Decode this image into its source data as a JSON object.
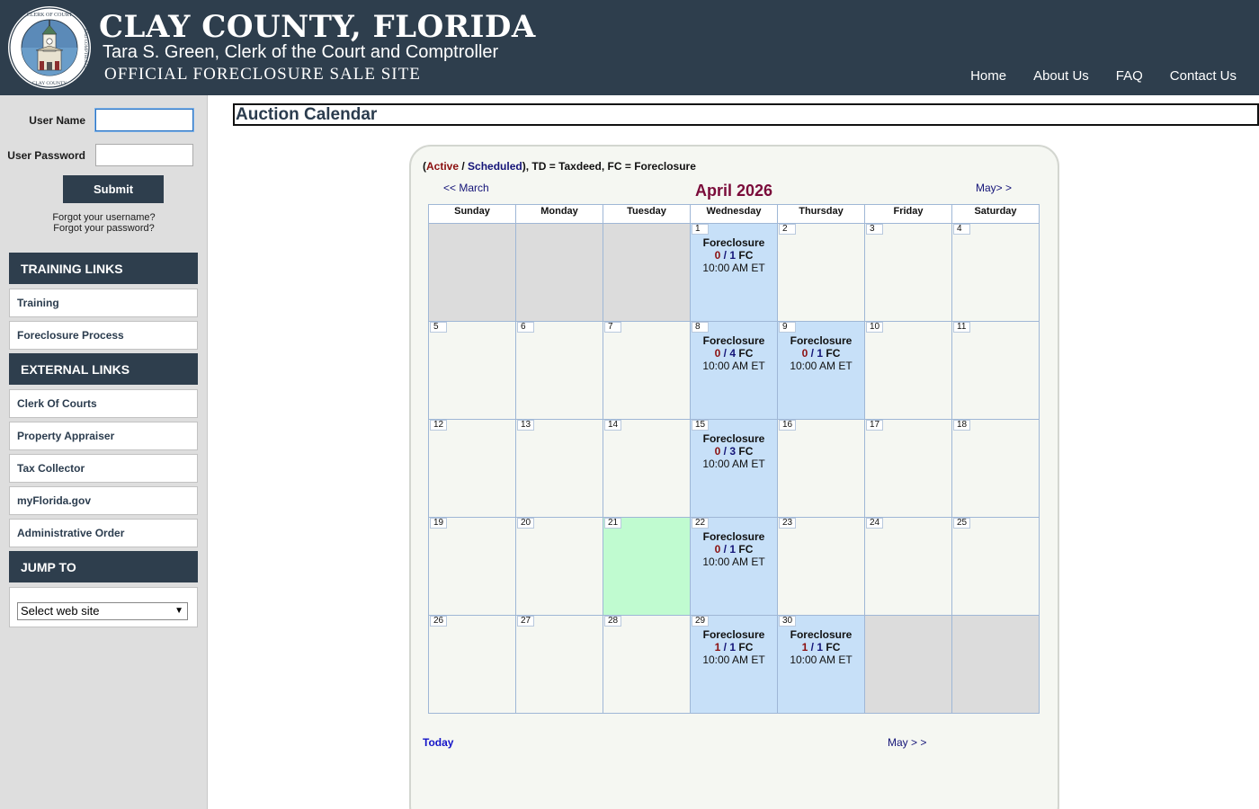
{
  "header": {
    "county": "CLAY COUNTY, FLORIDA",
    "clerk": "Tara S. Green, Clerk of the Court and Comptroller",
    "site": "OFFICIAL FORECLOSURE SALE SITE",
    "seal_top": "CLERK OF COURT",
    "seal_right": "AND COMPTROLLER",
    "seal_bottom": "CLAY COUNTY",
    "nav": [
      "Home",
      "About Us",
      "FAQ",
      "Contact Us"
    ]
  },
  "login": {
    "username_label": "User Name",
    "password_label": "User Password",
    "username_value": "",
    "password_value": "",
    "submit": "Submit",
    "forgot_username": "Forgot your username?",
    "forgot_password": "Forgot your password?"
  },
  "sidebar": {
    "training_head": "TRAINING LINKS",
    "training_links": [
      "Training",
      "Foreclosure Process"
    ],
    "external_head": "EXTERNAL LINKS",
    "external_links": [
      "Clerk Of Courts",
      "Property Appraiser",
      "Tax Collector",
      "myFlorida.gov",
      "Administrative Order"
    ],
    "jump_head": "JUMP TO",
    "jump_select": "Select web site"
  },
  "main": {
    "title": "Auction Calendar",
    "legend": {
      "open": "(",
      "active": "Active",
      "slash": " / ",
      "scheduled": "Scheduled",
      "rest": "), TD = Taxdeed, FC = Foreclosure"
    },
    "prev": "<< March",
    "next": "May> >",
    "month": "April 2026",
    "dow": [
      "Sunday",
      "Monday",
      "Tuesday",
      "Wednesday",
      "Thursday",
      "Friday",
      "Saturday"
    ],
    "weeks": [
      [
        {
          "day": "",
          "state": "empty"
        },
        {
          "day": "",
          "state": "empty"
        },
        {
          "day": "",
          "state": "empty"
        },
        {
          "day": "1",
          "state": "auction",
          "auction": {
            "type": "Foreclosure",
            "active": "0",
            "scheduled": "1",
            "code": "FC",
            "time": "10:00 AM ET"
          }
        },
        {
          "day": "2"
        },
        {
          "day": "3"
        },
        {
          "day": "4"
        }
      ],
      [
        {
          "day": "5"
        },
        {
          "day": "6"
        },
        {
          "day": "7"
        },
        {
          "day": "8",
          "state": "auction",
          "auction": {
            "type": "Foreclosure",
            "active": "0",
            "scheduled": "4",
            "code": "FC",
            "time": "10:00 AM ET"
          }
        },
        {
          "day": "9",
          "state": "auction",
          "auction": {
            "type": "Foreclosure",
            "active": "0",
            "scheduled": "1",
            "code": "FC",
            "time": "10:00 AM ET"
          }
        },
        {
          "day": "10"
        },
        {
          "day": "11"
        }
      ],
      [
        {
          "day": "12"
        },
        {
          "day": "13"
        },
        {
          "day": "14"
        },
        {
          "day": "15",
          "state": "auction",
          "auction": {
            "type": "Foreclosure",
            "active": "0",
            "scheduled": "3",
            "code": "FC",
            "time": "10:00 AM ET"
          }
        },
        {
          "day": "16"
        },
        {
          "day": "17"
        },
        {
          "day": "18"
        }
      ],
      [
        {
          "day": "19"
        },
        {
          "day": "20"
        },
        {
          "day": "21",
          "state": "today"
        },
        {
          "day": "22",
          "state": "auction",
          "auction": {
            "type": "Foreclosure",
            "active": "0",
            "scheduled": "1",
            "code": "FC",
            "time": "10:00 AM ET"
          }
        },
        {
          "day": "23"
        },
        {
          "day": "24"
        },
        {
          "day": "25"
        }
      ],
      [
        {
          "day": "26"
        },
        {
          "day": "27"
        },
        {
          "day": "28"
        },
        {
          "day": "29",
          "state": "auction",
          "auction": {
            "type": "Foreclosure",
            "active": "1",
            "scheduled": "1",
            "code": "FC",
            "time": "10:00 AM ET"
          }
        },
        {
          "day": "30",
          "state": "auction",
          "auction": {
            "type": "Foreclosure",
            "active": "1",
            "scheduled": "1",
            "code": "FC",
            "time": "10:00 AM ET"
          }
        },
        {
          "day": "",
          "state": "empty"
        },
        {
          "day": "",
          "state": "empty"
        }
      ]
    ],
    "today_link": "Today",
    "next_bottom": "May > >"
  },
  "colors": {
    "header_bg": "#2e3e4d",
    "auction_cell": "#c7e0f8",
    "today_cell": "#c0fbd0",
    "empty_cell": "#dcdcdc",
    "active_text": "#8b0f0f",
    "scheduled_text": "#141478",
    "month_title": "#7a0b3a"
  }
}
